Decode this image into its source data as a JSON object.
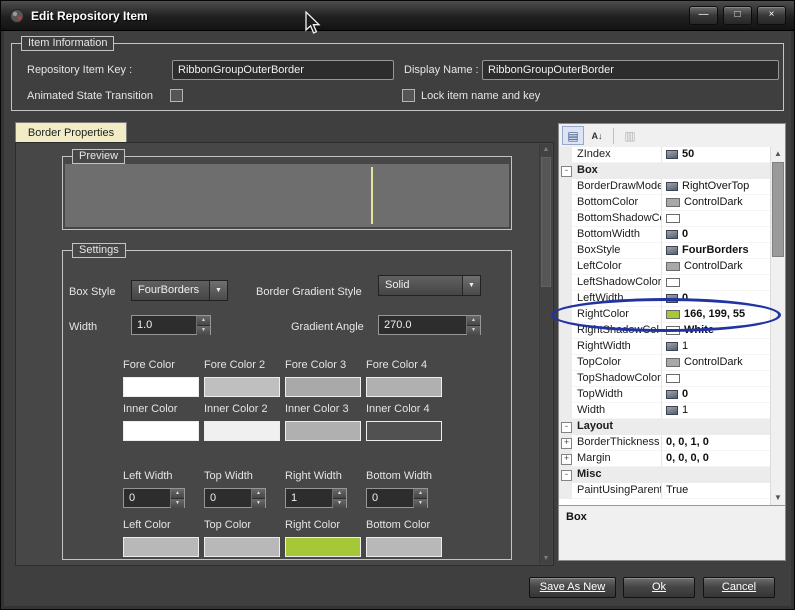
{
  "window": {
    "title": "Edit Repository Item"
  },
  "icons": {
    "minimize": "—",
    "maximize": "□",
    "close": "×",
    "dropdown_arrow": "▼",
    "spin_up": "▲",
    "spin_down": "▼",
    "scroll_up": "▲",
    "scroll_down": "▼",
    "collapse": "-",
    "expand": "+",
    "categorized": "▤",
    "alphabetical": "A↓",
    "property_pages": "▥"
  },
  "item_info": {
    "label": "Item Information",
    "key_label": "Repository Item Key :",
    "key_value": "RibbonGroupOuterBorder",
    "display_label": "Display Name :",
    "display_value": "RibbonGroupOuterBorder",
    "animated_label": "Animated State Transition",
    "lock_label": "Lock item name and key"
  },
  "tab_label": "Border Properties",
  "preview": {
    "label": "Preview",
    "line_color": "#e8e39c"
  },
  "settings": {
    "label": "Settings",
    "box_style_label": "Box Style",
    "box_style_value": "FourBorders",
    "gradient_style_label": "Border Gradient Style",
    "gradient_style_value": "Solid",
    "width_label": "Width",
    "width_value": "1.0",
    "angle_label": "Gradient Angle",
    "angle_value": "270.0",
    "fore_colors": [
      {
        "label": "Fore Color",
        "color": "#ffffff"
      },
      {
        "label": "Fore Color 2",
        "color": "#bfbfbf"
      },
      {
        "label": "Fore Color 3",
        "color": "#a9a9a9"
      },
      {
        "label": "Fore Color 4",
        "color": "#b0b0b0"
      }
    ],
    "inner_colors": [
      {
        "label": "Inner Color",
        "color": "#ffffff"
      },
      {
        "label": "Inner Color 2",
        "color": "#f0f0f0"
      },
      {
        "label": "Inner Color 3",
        "color": "#b0b0b0"
      },
      {
        "label": "Inner Color 4",
        "color": "#515151"
      }
    ],
    "border_widths": [
      {
        "label": "Left Width",
        "value": "0"
      },
      {
        "label": "Top Width",
        "value": "0"
      },
      {
        "label": "Right Width",
        "value": "1"
      },
      {
        "label": "Bottom Width",
        "value": "0"
      }
    ],
    "side_colors": [
      {
        "label": "Left Color",
        "color": "#b8b8b8"
      },
      {
        "label": "Top Color",
        "color": "#b8b8b8"
      },
      {
        "label": "Right Color",
        "color": "#a6c737"
      },
      {
        "label": "Bottom Color",
        "color": "#b8b8b8"
      }
    ]
  },
  "property_grid": {
    "rows": [
      {
        "name": "ZIndex",
        "value": "50",
        "bold": true,
        "icon": true
      },
      {
        "name": "Box",
        "category": true
      },
      {
        "name": "BorderDrawMode",
        "value": "RightOverTop",
        "icon": true
      },
      {
        "name": "BottomColor",
        "value": "ControlDark",
        "swatch": "#a8a8a8"
      },
      {
        "name": "BottomShadowCo",
        "value": "",
        "swatch": "#ffffff"
      },
      {
        "name": "BottomWidth",
        "value": "0",
        "bold": true,
        "icon": true
      },
      {
        "name": "BoxStyle",
        "value": "FourBorders",
        "bold": true,
        "icon": true
      },
      {
        "name": "LeftColor",
        "value": "ControlDark",
        "swatch": "#a8a8a8"
      },
      {
        "name": "LeftShadowColor",
        "value": "",
        "swatch": "#ffffff"
      },
      {
        "name": "LeftWidth",
        "value": "0",
        "bold": true,
        "icon": true
      },
      {
        "name": "RightColor",
        "value": "166, 199, 55",
        "bold": true,
        "swatch": "#a6c737"
      },
      {
        "name": "RightShadowCol",
        "value": "White",
        "bold": true,
        "swatch": "#ffffff"
      },
      {
        "name": "RightWidth",
        "value": "1",
        "icon": true
      },
      {
        "name": "TopColor",
        "value": "ControlDark",
        "swatch": "#a8a8a8"
      },
      {
        "name": "TopShadowColor",
        "value": "",
        "swatch": "#ffffff"
      },
      {
        "name": "TopWidth",
        "value": "0",
        "bold": true,
        "icon": true
      },
      {
        "name": "Width",
        "value": "1",
        "icon": true
      },
      {
        "name": "Layout",
        "category": true
      },
      {
        "name": "BorderThickness",
        "value": "0, 0, 1, 0",
        "bold": true,
        "expander": true
      },
      {
        "name": "Margin",
        "value": "0, 0, 0, 0",
        "bold": true,
        "expander": true
      },
      {
        "name": "Misc",
        "category": true
      },
      {
        "name": "PaintUsingParentS",
        "value": "True"
      }
    ],
    "description_title": "Box"
  },
  "footer": {
    "save_as_new": "Save As New",
    "ok": "Ok",
    "cancel": "Cancel"
  }
}
